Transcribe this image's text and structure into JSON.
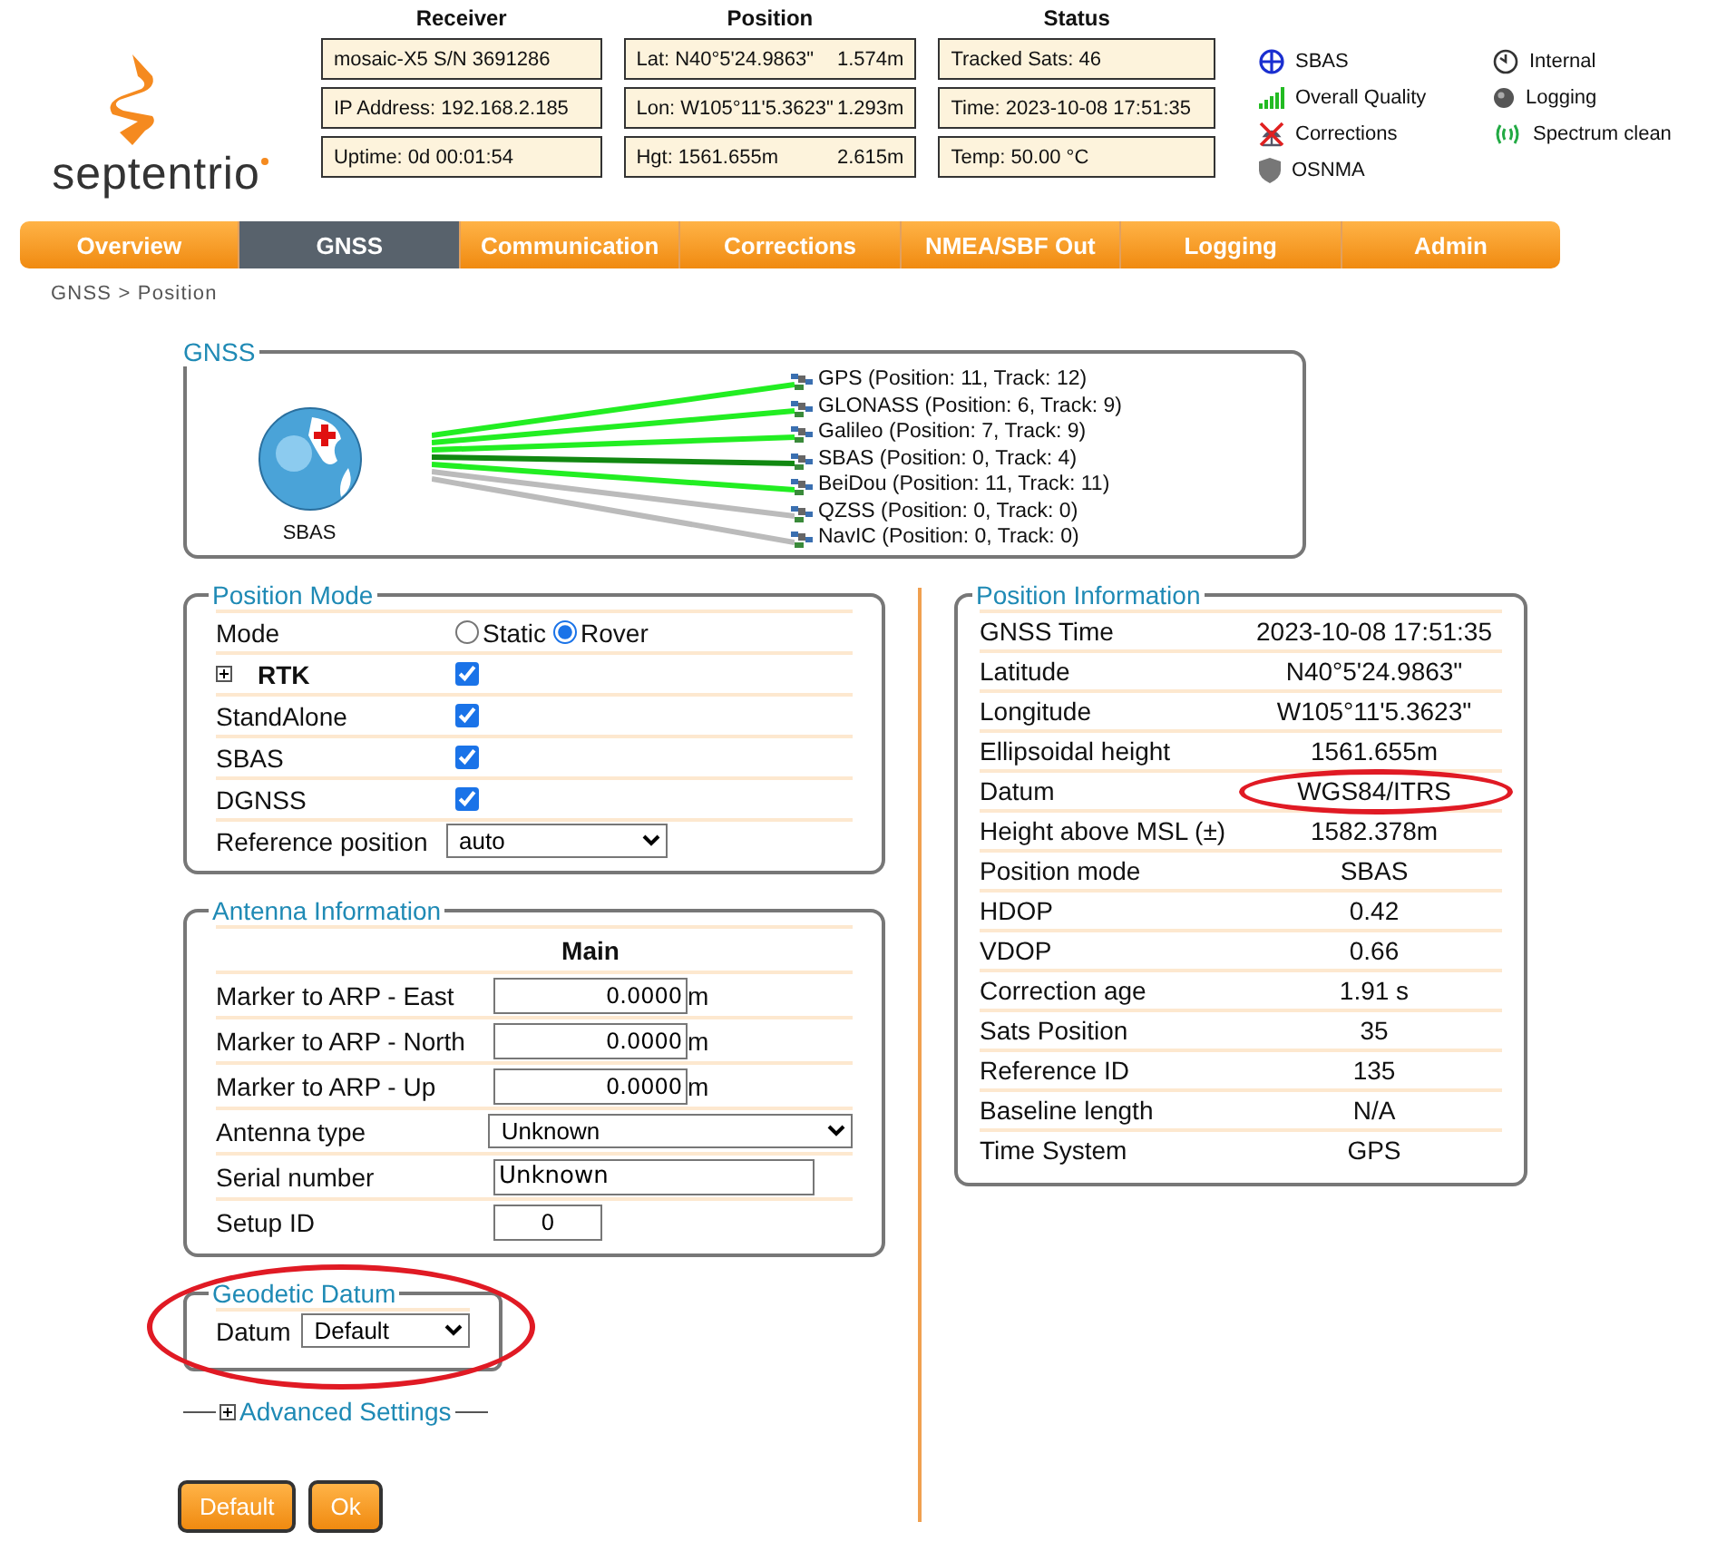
{
  "logo": {
    "text": "septentrio"
  },
  "status_panels": [
    {
      "heading": "Receiver",
      "cells": [
        {
          "text": "mosaic-X5 S/N 3691286"
        },
        {
          "text": "IP Address: 192.168.2.185"
        },
        {
          "text": "Uptime: 0d 00:01:54"
        }
      ]
    },
    {
      "heading": "Position",
      "cells": [
        {
          "text": "Lat:  N40°5'24.9863\"",
          "extra": "1.574m"
        },
        {
          "text": "Lon: W105°11'5.3623\"",
          "extra": "1.293m"
        },
        {
          "text": "Hgt: 1561.655m",
          "extra": "2.615m"
        }
      ]
    },
    {
      "heading": "Status",
      "cells": [
        {
          "text": "Tracked Sats: 46"
        },
        {
          "text": "Time: 2023-10-08 17:51:35"
        },
        {
          "text": "Temp: 50.00 °C"
        }
      ]
    }
  ],
  "legend": [
    [
      {
        "kind": "sbas",
        "label": "SBAS"
      },
      {
        "kind": "quality",
        "label": "Overall Quality"
      },
      {
        "kind": "corrections",
        "label": "Corrections"
      },
      {
        "kind": "osnma",
        "label": "OSNMA"
      }
    ],
    [
      {
        "kind": "internal",
        "label": "Internal"
      },
      {
        "kind": "logging",
        "label": "Logging"
      },
      {
        "kind": "spectrum",
        "label": "Spectrum clean"
      }
    ]
  ],
  "tabs": [
    {
      "label": "Overview",
      "selected": false
    },
    {
      "label": "GNSS",
      "selected": true
    },
    {
      "label": "Communication",
      "selected": false
    },
    {
      "label": "Corrections",
      "selected": false
    },
    {
      "label": "NMEA/SBF Out",
      "selected": false
    },
    {
      "label": "Logging",
      "selected": false
    },
    {
      "label": "Admin",
      "selected": false
    }
  ],
  "breadcrumb": "GNSS > Position",
  "gnss": {
    "title": "GNSS",
    "globe_label": "SBAS",
    "constellations": [
      {
        "label": "GPS (Position: 11, Track: 12)",
        "color": "#22ee22"
      },
      {
        "label": "GLONASS (Position: 6, Track: 9)",
        "color": "#22ee22"
      },
      {
        "label": "Galileo (Position: 7, Track: 9)",
        "color": "#22ee22"
      },
      {
        "label": "SBAS (Position: 0, Track: 4)",
        "color": "#118811"
      },
      {
        "label": "BeiDou (Position: 11, Track: 11)",
        "color": "#22ee22"
      },
      {
        "label": "QZSS (Position: 0, Track: 0)",
        "color": "#bbbbbb"
      },
      {
        "label": "NavIC (Position: 0, Track: 0)",
        "color": "#bbbbbb"
      }
    ]
  },
  "position_mode": {
    "title": "Position Mode",
    "mode": {
      "label": "Mode",
      "options": [
        {
          "label": "Static",
          "selected": false
        },
        {
          "label": "Rover",
          "selected": true
        }
      ]
    },
    "rows": [
      {
        "label": "RTK",
        "checked": true,
        "expandable": true
      },
      {
        "label": "StandAlone",
        "checked": true,
        "expandable": false
      },
      {
        "label": "SBAS",
        "checked": true,
        "expandable": false
      },
      {
        "label": "DGNSS",
        "checked": true,
        "expandable": false
      }
    ],
    "reference": {
      "label": "Reference position",
      "value": "auto"
    }
  },
  "antenna": {
    "title": "Antenna Information",
    "column_heading": "Main",
    "rows": [
      {
        "kind": "number",
        "label": "Marker to ARP - East",
        "value": "0.0000",
        "unit": "m"
      },
      {
        "kind": "number",
        "label": "Marker to ARP - North",
        "value": "0.0000",
        "unit": "m"
      },
      {
        "kind": "number",
        "label": "Marker to ARP - Up",
        "value": "0.0000",
        "unit": "m"
      },
      {
        "kind": "select",
        "label": "Antenna type",
        "value": "Unknown"
      },
      {
        "kind": "text",
        "label": "Serial number",
        "value": "Unknown"
      },
      {
        "kind": "id",
        "label": "Setup ID",
        "value": "0"
      }
    ]
  },
  "geodetic": {
    "title": "Geodetic Datum",
    "circled": true,
    "datum": {
      "label": "Datum",
      "value": "Default"
    }
  },
  "advanced": {
    "label": "Advanced Settings",
    "expanded": false
  },
  "buttons": [
    "Default",
    "Ok"
  ],
  "position_info": {
    "title": "Position Information",
    "rows": [
      {
        "label": "GNSS Time",
        "value": "2023-10-08 17:51:35",
        "circled": false
      },
      {
        "label": "Latitude",
        "value": "N40°5'24.9863\"",
        "circled": false
      },
      {
        "label": "Longitude",
        "value": "W105°11'5.3623\"",
        "circled": false
      },
      {
        "label": "Ellipsoidal height",
        "value": "1561.655m",
        "circled": false
      },
      {
        "label": "Datum",
        "value": "WGS84/ITRS",
        "circled": true
      },
      {
        "label": "Height above MSL (±)",
        "value": "1582.378m",
        "circled": false
      },
      {
        "label": "Position mode",
        "value": "SBAS",
        "circled": false
      },
      {
        "label": "HDOP",
        "value": "0.42",
        "circled": false
      },
      {
        "label": "VDOP",
        "value": "0.66",
        "circled": false
      },
      {
        "label": "Correction age",
        "value": "1.91 s",
        "circled": false
      },
      {
        "label": "Sats Position",
        "value": "35",
        "circled": false
      },
      {
        "label": "Reference ID",
        "value": "135",
        "circled": false
      },
      {
        "label": "Baseline length",
        "value": "N/A",
        "circled": false
      },
      {
        "label": "Time System",
        "value": "GPS",
        "circled": false
      }
    ]
  }
}
